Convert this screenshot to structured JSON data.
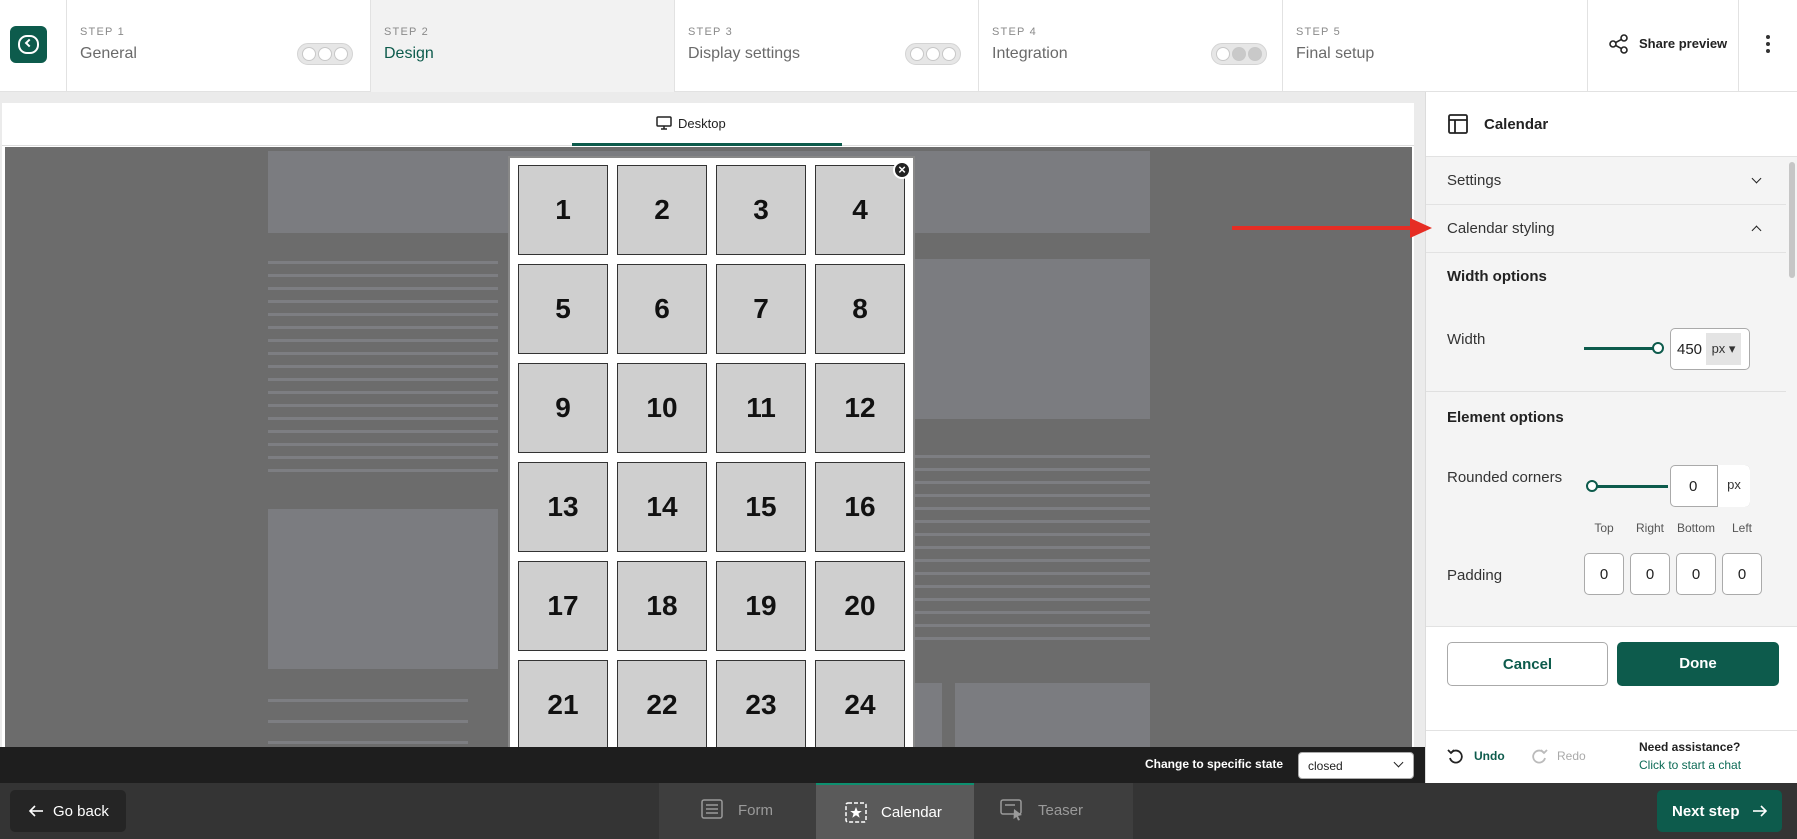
{
  "steps": [
    {
      "num": "STEP 1",
      "name": "General"
    },
    {
      "num": "STEP 2",
      "name": "Design"
    },
    {
      "num": "STEP 3",
      "name": "Display settings"
    },
    {
      "num": "STEP 4",
      "name": "Integration"
    },
    {
      "num": "STEP 5",
      "name": "Final setup"
    }
  ],
  "header": {
    "share_label": "Share preview"
  },
  "preview": {
    "device_tab": "Desktop",
    "calendar_days": [
      "1",
      "2",
      "3",
      "4",
      "5",
      "6",
      "7",
      "8",
      "9",
      "10",
      "11",
      "12",
      "13",
      "14",
      "15",
      "16",
      "17",
      "18",
      "19",
      "20",
      "21",
      "22",
      "23",
      "24"
    ]
  },
  "statebar": {
    "label": "Change to specific state",
    "selected_state": "closed"
  },
  "bottombar": {
    "go_back": "Go back",
    "modes": [
      {
        "label": "Form",
        "icon": "form-icon"
      },
      {
        "label": "Calendar",
        "icon": "calendar-star-icon",
        "active": true
      },
      {
        "label": "Teaser",
        "icon": "teaser-icon"
      }
    ],
    "next_step": "Next step"
  },
  "panel": {
    "title": "Calendar",
    "accordions": {
      "settings": "Settings",
      "styling": "Calendar styling"
    },
    "width_options": {
      "title": "Width options",
      "width_label": "Width",
      "width_value": "450",
      "unit": "px ▾",
      "slider_level": 1.0
    },
    "element_options": {
      "title": "Element options",
      "rounded_label": "Rounded corners",
      "rounded_value": "0",
      "rounded_unit": "px",
      "rounded_slider_level": 0.0,
      "sides": [
        "Top",
        "Right",
        "Bottom",
        "Left"
      ],
      "padding_label": "Padding",
      "padding_values": [
        "0",
        "0",
        "0",
        "0"
      ]
    },
    "cancel": "Cancel",
    "done": "Done",
    "undo": "Undo",
    "redo": "Redo",
    "assistance_title": "Need assistance?",
    "assistance_link": "Click to start a chat"
  },
  "colors": {
    "brand": "#0d5b4c",
    "annotation_arrow": "#e62d24"
  }
}
